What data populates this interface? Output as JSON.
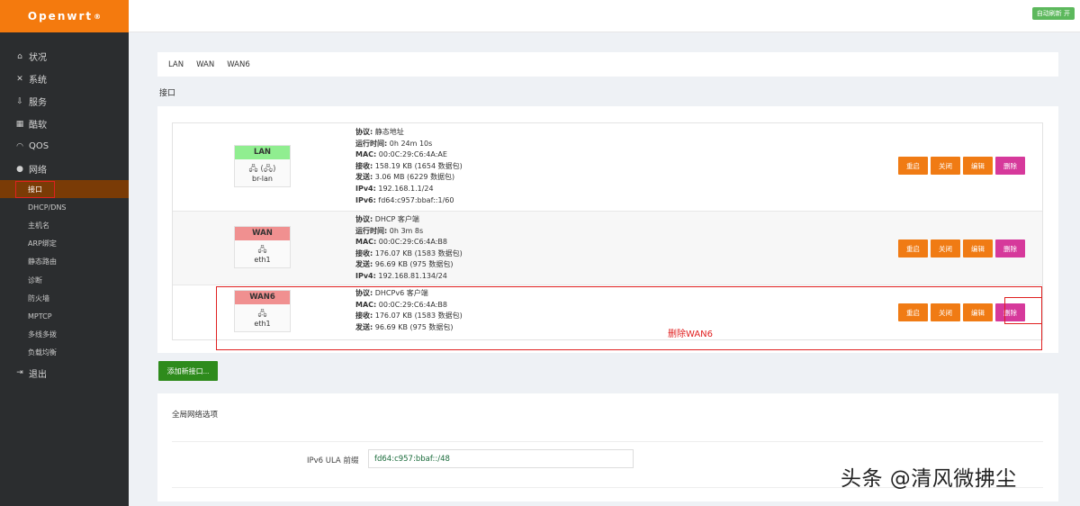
{
  "brand": {
    "name": "Openwrt",
    "mark": "®"
  },
  "topbar": {
    "auto_refresh": "自动刷新 开"
  },
  "sidebar": {
    "items": [
      {
        "icon": "home-icon",
        "glyph": "⌂",
        "label": "状况"
      },
      {
        "icon": "tools-icon",
        "glyph": "✕",
        "label": "系统"
      },
      {
        "icon": "download-icon",
        "glyph": "⇩",
        "label": "服务"
      },
      {
        "icon": "calendar-icon",
        "glyph": "▦",
        "label": "酷软"
      },
      {
        "icon": "gauge-icon",
        "glyph": "◠",
        "label": "QOS"
      },
      {
        "icon": "globe-icon",
        "glyph": "●",
        "label": "网络"
      }
    ],
    "submenu": [
      {
        "label": "接口",
        "active": true
      },
      {
        "label": "DHCP/DNS"
      },
      {
        "label": "主机名"
      },
      {
        "label": "ARP绑定"
      },
      {
        "label": "静态路由"
      },
      {
        "label": "诊断"
      },
      {
        "label": "防火墙"
      },
      {
        "label": "MPTCP"
      },
      {
        "label": "多线多拨"
      },
      {
        "label": "负载均衡"
      }
    ],
    "logout": {
      "icon": "logout-icon",
      "glyph": "⇥",
      "label": "退出"
    }
  },
  "tabs": [
    "LAN",
    "WAN",
    "WAN6"
  ],
  "section_title": "接口",
  "interfaces": [
    {
      "name": "LAN",
      "color": "#90ee90",
      "icon": "🖧 (🖧)",
      "device": "br-lan",
      "info": [
        [
          "协议:",
          "静态地址"
        ],
        [
          "运行时间:",
          "0h 24m 10s"
        ],
        [
          "MAC:",
          "00:0C:29:C6:4A:AE"
        ],
        [
          "接收:",
          "158.19 KB (1654 数据包)"
        ],
        [
          "发送:",
          "3.06 MB (6229 数据包)"
        ],
        [
          "IPv4:",
          "192.168.1.1/24"
        ],
        [
          "IPv6:",
          "fd64:c957:bbaf::1/60"
        ]
      ]
    },
    {
      "name": "WAN",
      "color": "#f09090",
      "icon": "🖧",
      "device": "eth1",
      "info": [
        [
          "协议:",
          "DHCP 客户端"
        ],
        [
          "运行时间:",
          "0h 3m 8s"
        ],
        [
          "MAC:",
          "00:0C:29:C6:4A:B8"
        ],
        [
          "接收:",
          "176.07 KB (1583 数据包)"
        ],
        [
          "发送:",
          "96.69 KB (975 数据包)"
        ],
        [
          "IPv4:",
          "192.168.81.134/24"
        ]
      ]
    },
    {
      "name": "WAN6",
      "color": "#f09090",
      "icon": "🖧",
      "device": "eth1",
      "info": [
        [
          "协议:",
          "DHCPv6 客户端"
        ],
        [
          "MAC:",
          "00:0C:29:C6:4A:B8"
        ],
        [
          "接收:",
          "176.07 KB (1583 数据包)"
        ],
        [
          "发送:",
          "96.69 KB (975 数据包)"
        ]
      ]
    }
  ],
  "actions": {
    "restart": "重启",
    "stop": "关闭",
    "edit": "编辑",
    "delete": "删除"
  },
  "annotation": "删除WAN6",
  "add_button": "添加新接口...",
  "global": {
    "title": "全局网络选项",
    "ula_label": "IPv6 ULA 前缀",
    "ula_value": "fd64:c957:bbaf::/48"
  },
  "watermark": "头条 @清风微拂尘",
  "colors": {
    "accent": "#f47a0e",
    "sidebar_bg": "#2b2d2f",
    "delete": "#d6399b",
    "add": "#2e8b1c",
    "highlight": "#e02020"
  }
}
